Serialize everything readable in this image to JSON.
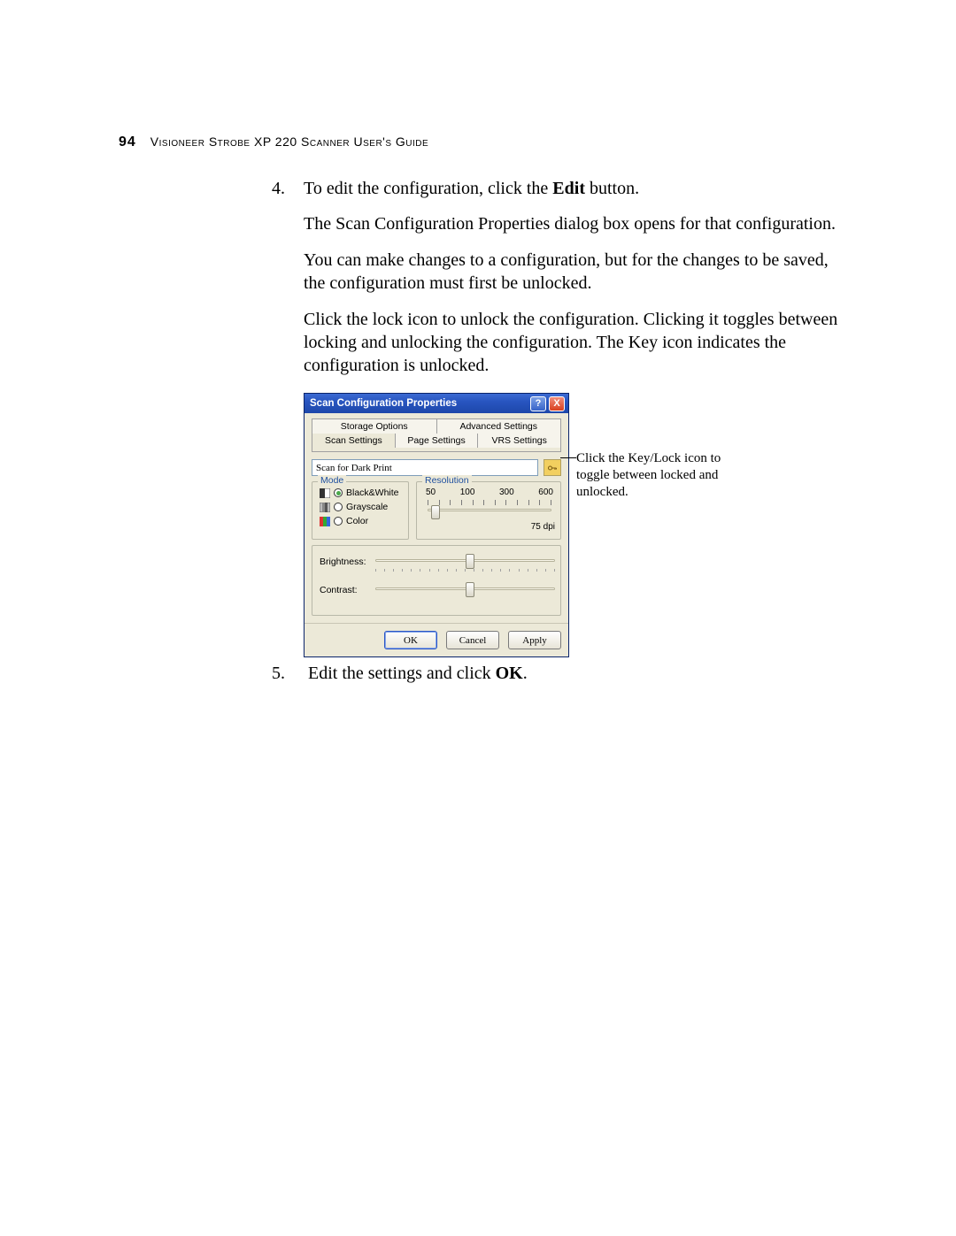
{
  "header": {
    "page_number": "94",
    "guide_title": "Visioneer Strobe XP 220 Scanner User's Guide"
  },
  "steps": {
    "s4_num": "4.",
    "s4_p1_a": "To edit the configuration, click the ",
    "s4_p1_b": "Edit",
    "s4_p1_c": " button.",
    "s4_p2": "The Scan Configuration Properties dialog box opens for that configuration.",
    "s4_p3": "You can make changes to a configuration, but for the changes to be saved, the configuration must first be unlocked.",
    "s4_p4": "Click the lock icon to unlock the configuration. Clicking it toggles between locking and unlocking the configuration. The Key icon indicates the configuration is unlocked.",
    "s5_num": "5.",
    "s5_p1_a": "Edit the settings and click ",
    "s5_p1_b": "OK",
    "s5_p1_c": "."
  },
  "callout": "Click the Key/Lock icon to toggle between locked and unlocked.",
  "dialog": {
    "title": "Scan Configuration Properties",
    "help": "?",
    "close": "X",
    "tabs": {
      "storage": "Storage Options",
      "advanced": "Advanced Settings",
      "scan": "Scan Settings",
      "page": "Page Settings",
      "vrs": "VRS Settings"
    },
    "config_name": "Scan for Dark Print",
    "mode": {
      "legend": "Mode",
      "bw": "Black&White",
      "gray": "Grayscale",
      "color": "Color"
    },
    "resolution": {
      "legend": "Resolution",
      "t50": "50",
      "t100": "100",
      "t300": "300",
      "t600": "600",
      "value": "75 dpi"
    },
    "brightness_label": "Brightness:",
    "contrast_label": "Contrast:",
    "buttons": {
      "ok": "OK",
      "cancel": "Cancel",
      "apply": "Apply"
    }
  }
}
